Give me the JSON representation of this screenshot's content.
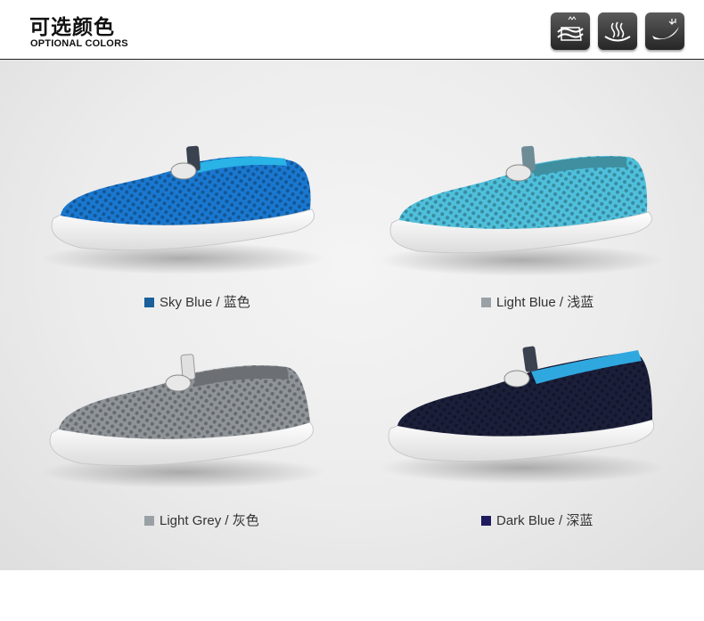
{
  "header": {
    "title_cn": "可选颜色",
    "title_en": "OPTIONAL COLORS",
    "feature_icons": [
      "breathable-mesh-icon",
      "ventilation-icon",
      "flexible-sole-icon"
    ]
  },
  "products": [
    {
      "label": "Sky Blue / 蓝色",
      "swatch_color": "#1a5e9a",
      "upper_color": "#1a78d0",
      "collar_color": "#2ab3e6"
    },
    {
      "label": "Light Blue / 浅蓝",
      "swatch_color": "#5bc5e6",
      "upper_color": "#4fc0dc",
      "collar_color": "#3f8fa0"
    },
    {
      "label": "Light Grey / 灰色",
      "swatch_color": "#9aa1a6",
      "upper_color": "#8f9499",
      "collar_color": "#6c7074"
    },
    {
      "label": "Dark Blue / 深蓝",
      "swatch_color": "#1e1a5e",
      "upper_color": "#1b1f3a",
      "collar_color": "#2fa8e0"
    }
  ]
}
